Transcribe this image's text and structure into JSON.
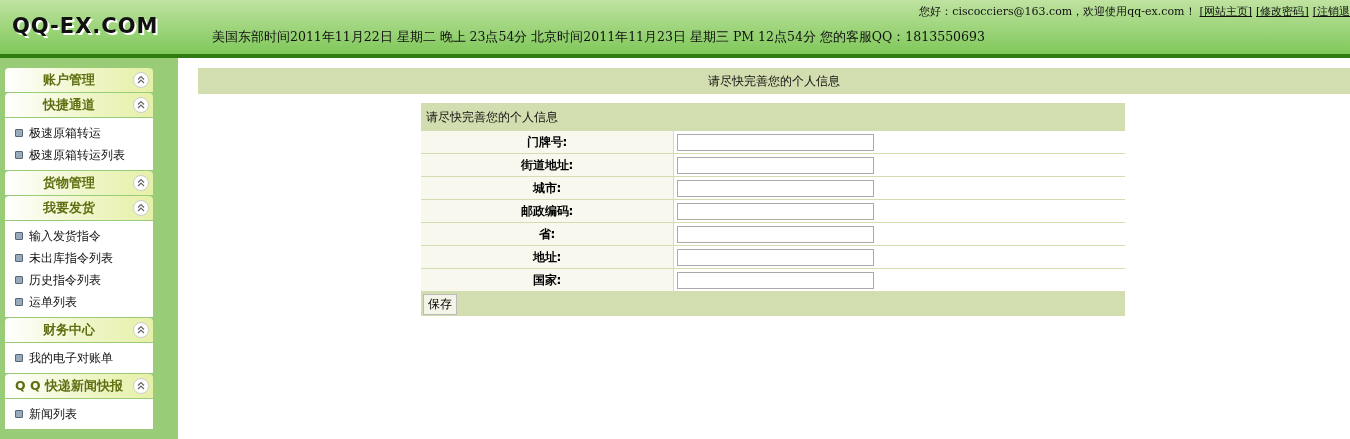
{
  "header": {
    "logo": "QQ-EX.COM",
    "greeting": "您好：ciscocciers@163.com，欢迎使用qq-ex.com！",
    "links": [
      "[网站主页]",
      "[修改密码]",
      "[注销退"
    ],
    "time_line": "美国东部时间2011年11月22日 星期二 晚上 23点54分 北京时间2011年11月23日 星期三 PM 12点54分 您的客服QQ：1813550693"
  },
  "sidebar": [
    {
      "title": "账户管理"
    },
    {
      "title": "快捷通道",
      "items": [
        "极速原箱转运",
        "极速原箱转运列表"
      ]
    },
    {
      "title": "货物管理"
    },
    {
      "title": "我要发货",
      "items": [
        "输入发货指令",
        "未出库指令列表",
        "历史指令列表",
        "运单列表"
      ]
    },
    {
      "title": "财务中心",
      "items": [
        "我的电子对账单"
      ]
    },
    {
      "title": "Q Q 快递新闻快报",
      "items": [
        "新闻列表"
      ]
    }
  ],
  "page_title": "请尽快完善您的个人信息",
  "form": {
    "title": "请尽快完善您的个人信息",
    "fields": [
      "门牌号:",
      "街道地址:",
      "城市:",
      "邮政编码:",
      "省:",
      "地址:",
      "国家:"
    ],
    "button": "保存"
  }
}
